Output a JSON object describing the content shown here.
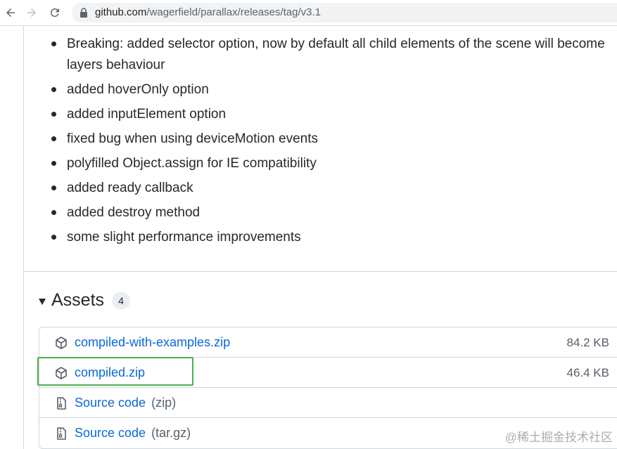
{
  "browser": {
    "url_host": "github.com",
    "url_path": "/wagerfield/parallax/releases/tag/v3.1"
  },
  "release_notes": {
    "items": [
      {
        "bold": "Breaking:",
        "text": " added selector option, now by default all child elements of the scene will become layers behaviour"
      },
      {
        "bold": "",
        "text": "added hoverOnly option"
      },
      {
        "bold": "",
        "text": "added inputElement option"
      },
      {
        "bold": "",
        "text": "fixed bug when using deviceMotion events"
      },
      {
        "bold": "",
        "text": "polyfilled Object.assign for IE compatibility"
      },
      {
        "bold": "",
        "text": "added ready callback"
      },
      {
        "bold": "",
        "text": "added destroy method"
      },
      {
        "bold": "",
        "text": "some slight performance improvements"
      }
    ]
  },
  "assets": {
    "title": "Assets",
    "count": "4",
    "rows": [
      {
        "name": "compiled-with-examples.zip",
        "ext": "",
        "size": "84.2 KB",
        "icon": "package-icon"
      },
      {
        "name": "compiled.zip",
        "ext": "",
        "size": "46.4 KB",
        "icon": "package-icon"
      },
      {
        "name": "Source code",
        "ext": "(zip)",
        "size": "",
        "icon": "file-zip-icon"
      },
      {
        "name": "Source code",
        "ext": "(tar.gz)",
        "size": "",
        "icon": "file-zip-icon"
      }
    ]
  },
  "watermark": "@稀土掘金技术社区",
  "colors": {
    "link": "#0969da",
    "highlight": "#4caf50",
    "muted": "#57606a"
  }
}
